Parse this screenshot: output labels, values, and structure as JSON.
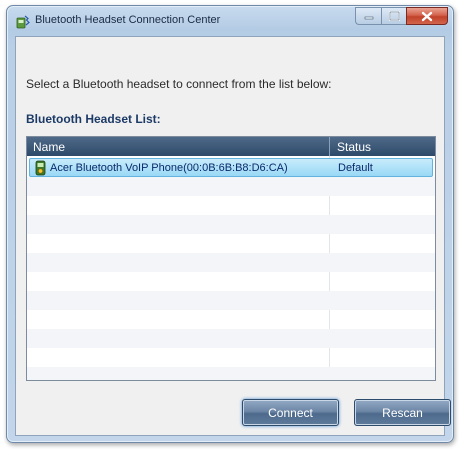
{
  "window": {
    "title": "Bluetooth Headset Connection Center",
    "minimize_label": "",
    "maximize_label": "",
    "close_label": ""
  },
  "dialog": {
    "instruction": "Select a Bluetooth headset to connect from the list below:",
    "list_label": "Bluetooth Headset List:"
  },
  "list": {
    "columns": [
      "Name",
      "Status"
    ],
    "rows": [
      {
        "name": "Acer Bluetooth VoIP Phone(00:0B:6B:B8:D6:CA)",
        "status": "Default",
        "icon": "bluetooth-phone-icon",
        "selected": true
      }
    ]
  },
  "buttons": {
    "connect": "Connect",
    "rescan": "Rescan"
  },
  "colors": {
    "header": "#2e4a6a",
    "selection": "#99d8f6",
    "button": "#5f7b9c",
    "close": "#c14129"
  }
}
